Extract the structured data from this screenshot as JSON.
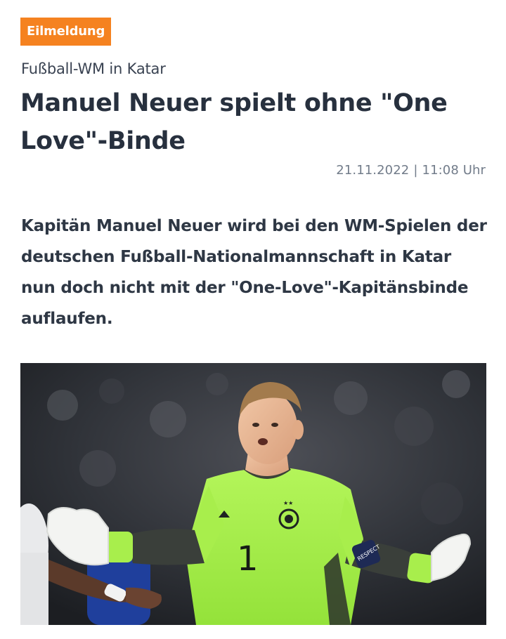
{
  "article": {
    "badge": "Eilmeldung",
    "kicker": "Fußball-WM in Katar",
    "headline": "Manuel Neuer spielt ohne \"One Love\"-Binde",
    "date": "21.11.2022",
    "separator": "|",
    "time": "11:08 Uhr",
    "lead": "Kapitän Manuel Neuer wird bei den WM-Spielen der deutschen Fußball-Nationalmannschaft in Katar nun doch nicht mit der \"One-Love\"-Kapitänsbinde auflaufen."
  },
  "photo": {
    "jersey_number": "1",
    "armband_text": "RESPECT"
  },
  "colors": {
    "badge": "#f58220",
    "text": "#27303e",
    "meta": "#727c8a",
    "jersey": "#a6ef4a"
  }
}
